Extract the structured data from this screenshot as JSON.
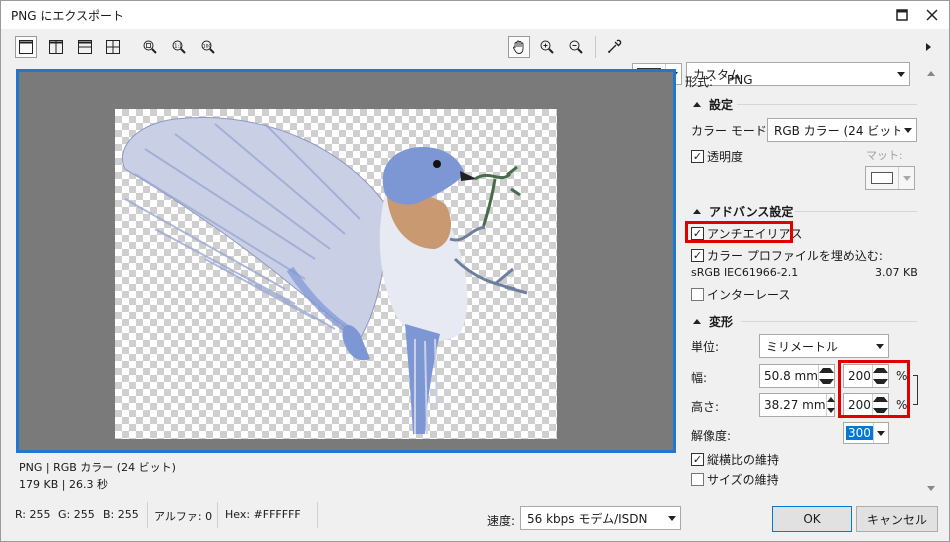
{
  "window": {
    "title": "PNG にエクスポート"
  },
  "toolbar": {
    "preset_value": "カスタム"
  },
  "preview": {
    "info_line1": "PNG  |  RGB カラー (24 ビット)",
    "info_line2": "179 KB  |  26.3 秒"
  },
  "status": {
    "r": "R: 255",
    "g": "G: 255",
    "b": "B: 255",
    "alpha": "アルファ: 0",
    "hex": "Hex: #FFFFFF",
    "speed_label": "速度:",
    "speed_value": "56 kbps モデム/ISDN"
  },
  "panel": {
    "format_label": "形式:",
    "format_value": "PNG",
    "settings_header": "設定",
    "color_mode_label": "カラー モード:",
    "color_mode_value": "RGB カラー (24 ビット)",
    "transparency_label": "透明度",
    "matte_label": "マット:",
    "advanced_header": "アドバンス設定",
    "antialias_label": "アンチエイリアス",
    "embed_profile_label": "カラー プロファイルを埋め込む:",
    "profile_name": "sRGB IEC61966-2.1",
    "profile_size": "3.07 KB",
    "interlace_label": "インターレース",
    "transform_header": "変形",
    "unit_label": "単位:",
    "unit_value": "ミリメートル",
    "width_label": "幅:",
    "width_value": "50.8 mm",
    "width_percent": "200",
    "height_label": "高さ:",
    "height_value": "38.27 mm",
    "height_percent": "200",
    "percent_sign": "%",
    "resolution_label": "解像度:",
    "resolution_value": "300",
    "keep_ratio_label": "縦横比の維持",
    "keep_size_label": "サイズの維持"
  },
  "buttons": {
    "ok": "OK",
    "cancel": "キャンセル"
  },
  "colors": {
    "accent": "#1e78d2",
    "highlight": "#e00000",
    "bird_blue": "#7d96d4",
    "bird_orange": "#c99a72"
  }
}
